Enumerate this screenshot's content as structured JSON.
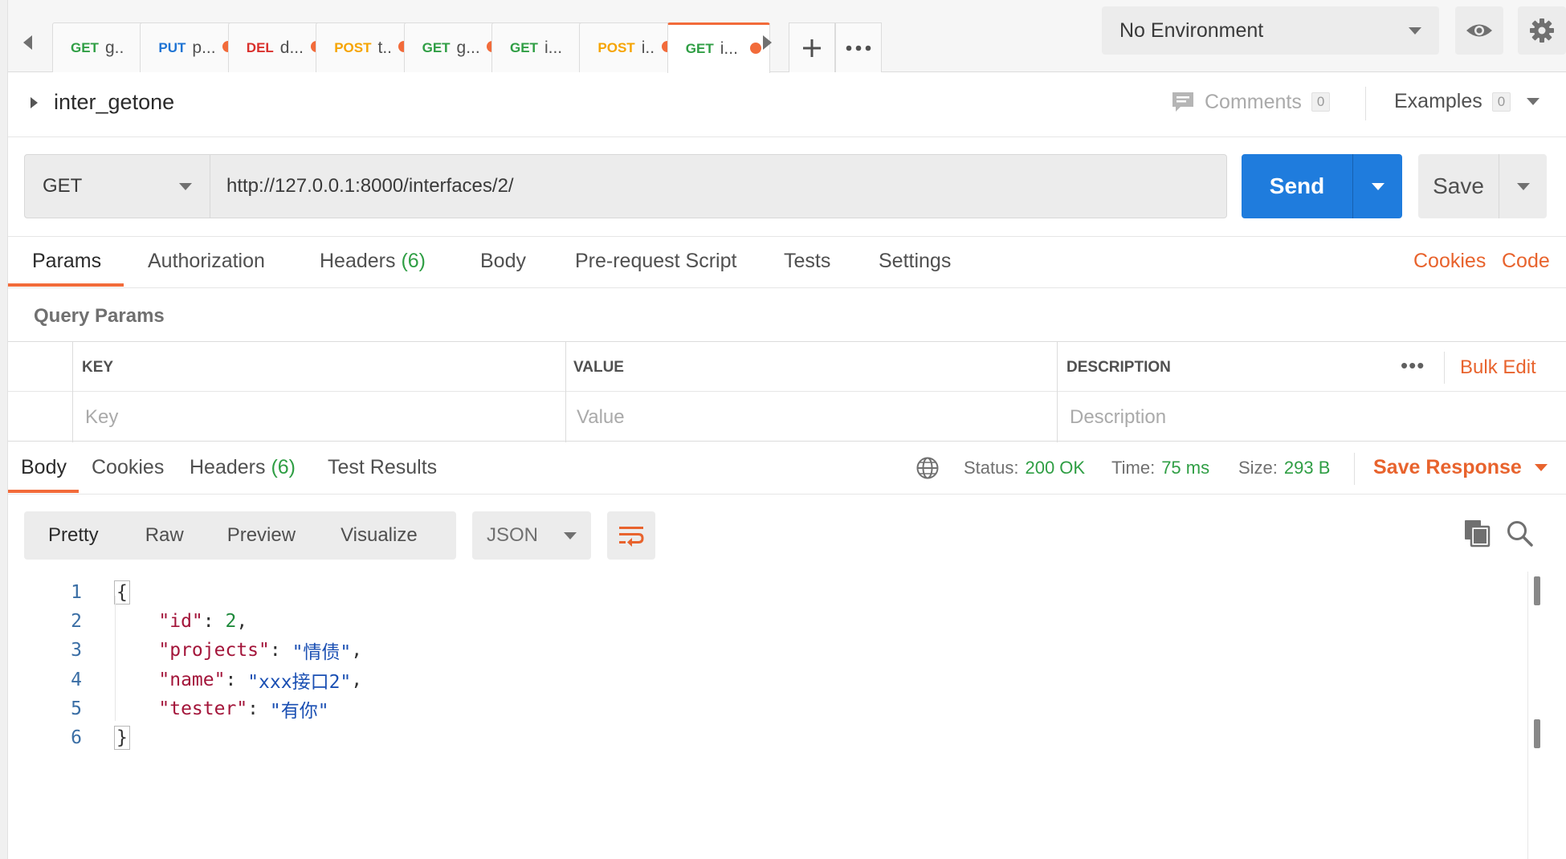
{
  "tabs": [
    {
      "method": "GET",
      "label": "g..",
      "dirty": false,
      "method_color": "#2f9e44"
    },
    {
      "method": "PUT",
      "label": "p...",
      "dirty": true,
      "method_color": "#1f74d4"
    },
    {
      "method": "DEL",
      "label": "d...",
      "dirty": true,
      "method_color": "#d9302c"
    },
    {
      "method": "POST",
      "label": "t..",
      "dirty": true,
      "method_color": "#f6a400"
    },
    {
      "method": "GET",
      "label": "g...",
      "dirty": true,
      "method_color": "#2f9e44"
    },
    {
      "method": "GET",
      "label": "i...",
      "dirty": false,
      "method_color": "#2f9e44"
    },
    {
      "method": "POST",
      "label": "i..",
      "dirty": true,
      "method_color": "#f6a400"
    },
    {
      "method": "GET",
      "label": "i...",
      "dirty": true,
      "method_color": "#2f9e44",
      "active": true
    }
  ],
  "tabbar": {
    "plus_icon": "plus-icon",
    "more_icon": "more-icon",
    "prev_icon": "chevron-left-icon",
    "next_icon": "chevron-right-icon"
  },
  "environment": {
    "selected": "No Environment"
  },
  "request": {
    "name": "inter_getone",
    "comments_label": "Comments",
    "comments_count": "0",
    "examples_label": "Examples",
    "examples_count": "0",
    "method": "GET",
    "url": "http://127.0.0.1:8000/interfaces/2/",
    "send_label": "Send",
    "save_label": "Save"
  },
  "request_tabs": {
    "params": "Params",
    "authorization": "Authorization",
    "headers": "Headers",
    "headers_count": "(6)",
    "body": "Body",
    "prerequest": "Pre-request Script",
    "tests": "Tests",
    "settings": "Settings",
    "cookies": "Cookies",
    "code": "Code"
  },
  "query_params": {
    "title": "Query Params",
    "columns": {
      "key": "KEY",
      "value": "VALUE",
      "description": "DESCRIPTION"
    },
    "placeholders": {
      "key": "Key",
      "value": "Value",
      "description": "Description"
    },
    "more": "•••",
    "bulk_edit": "Bulk Edit"
  },
  "response": {
    "tabs": {
      "body": "Body",
      "cookies": "Cookies",
      "headers": "Headers",
      "headers_count": "(6)",
      "tests": "Test Results"
    },
    "status_label": "Status:",
    "status_value": "200 OK",
    "time_label": "Time:",
    "time_value": "75 ms",
    "size_label": "Size:",
    "size_value": "293 B",
    "save_response": "Save Response",
    "formats": {
      "pretty": "Pretty",
      "raw": "Raw",
      "preview": "Preview",
      "visualize": "Visualize"
    },
    "language": "JSON",
    "code_lines": [
      {
        "n": "1",
        "text": "{"
      },
      {
        "n": "2",
        "key": "\"id\"",
        "value": "2",
        "vtype": "num",
        "trail": ","
      },
      {
        "n": "3",
        "key": "\"projects\"",
        "value": "\"情债\"",
        "vtype": "str",
        "trail": ","
      },
      {
        "n": "4",
        "key": "\"name\"",
        "value": "\"xxx接口2\"",
        "vtype": "str",
        "trail": ","
      },
      {
        "n": "5",
        "key": "\"tester\"",
        "value": "\"有你\"",
        "vtype": "str",
        "trail": ""
      },
      {
        "n": "6",
        "text": "}"
      }
    ]
  },
  "colors": {
    "accent": "#f26b3a",
    "send": "#1f7cdd",
    "success": "#2f9e44"
  }
}
